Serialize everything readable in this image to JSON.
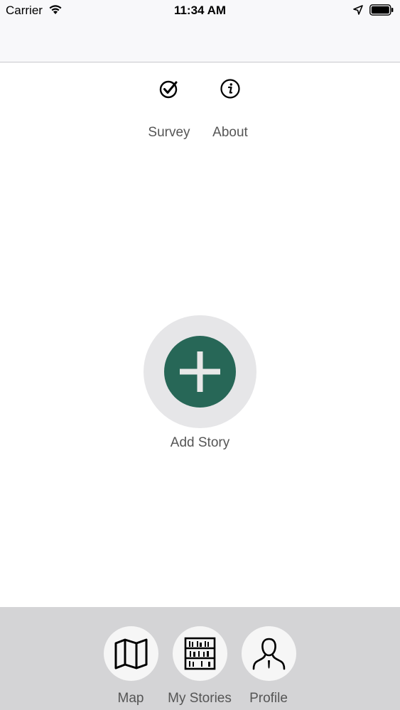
{
  "status_bar": {
    "carrier": "Carrier",
    "time": "11:34 AM"
  },
  "shortcuts": [
    {
      "label": "Survey",
      "icon": "checkmark-circle-icon"
    },
    {
      "label": "About",
      "icon": "info-circle-icon"
    }
  ],
  "add_story": {
    "label": "Add Story",
    "icon": "plus-icon",
    "color": "#276757"
  },
  "tabs": [
    {
      "label": "Map",
      "icon": "map-icon"
    },
    {
      "label": "My Stories",
      "icon": "bookshelf-icon"
    },
    {
      "label": "Profile",
      "icon": "person-icon"
    }
  ]
}
